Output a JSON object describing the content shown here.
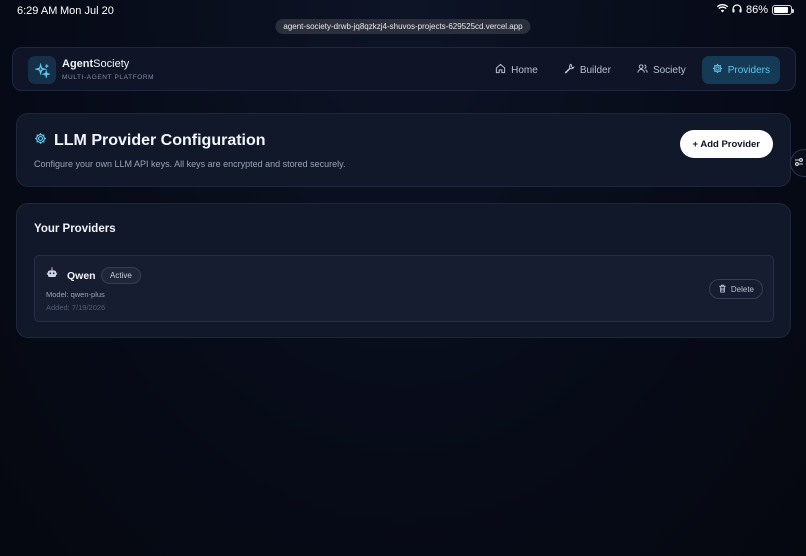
{
  "status_bar": {
    "time": "6:29 AM",
    "date": "Mon Jul 20",
    "battery": "86%",
    "battery_level": 0.86,
    "url": "agent-society-drwb-jq8qzkzj4-shuvos-projects-629525cd.vercel.app"
  },
  "brand": {
    "name_bold": "Agent",
    "name_rest": "Society",
    "subtitle": "MULTI-AGENT PLATFORM"
  },
  "nav": {
    "items": [
      {
        "label": "Home",
        "icon": "home-icon"
      },
      {
        "label": "Builder",
        "icon": "wrench-icon"
      },
      {
        "label": "Society",
        "icon": "users-icon"
      },
      {
        "label": "Providers",
        "icon": "gear-icon",
        "active": true
      }
    ]
  },
  "config": {
    "title": "LLM Provider Configuration",
    "description": "Configure your own LLM API keys. All keys are encrypted and stored securely.",
    "add_button": "+ Add Provider"
  },
  "providers": {
    "heading": "Your Providers",
    "items": [
      {
        "icon": "robot-icon",
        "name": "Qwen",
        "status": "Active",
        "model": "Model: qwen-plus",
        "added": "Added: 7/19/2026",
        "delete_label": "Delete"
      }
    ]
  },
  "colors": {
    "background": "#070b18",
    "accent": "#5dc8f0",
    "active_nav_bg": "#143a55"
  }
}
